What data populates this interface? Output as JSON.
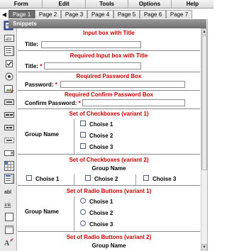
{
  "menu": {
    "items": [
      "Form",
      "Edit",
      "Tools",
      "Options",
      "Help"
    ]
  },
  "tabs": {
    "items": [
      "Page 1",
      "Page 2",
      "Page 3",
      "Page 4",
      "Page 5",
      "Page 6",
      "Page 7"
    ],
    "active": "Page 1"
  },
  "panel": {
    "title": "Snippets"
  },
  "toolbox": {
    "icons": [
      "snippets-icon",
      "text-field-icon",
      "textarea-icon",
      "checkbox-icon",
      "radio-icon",
      "image-edit-icon",
      "button-icon",
      "submit-button-icon",
      "reset-button-icon",
      "hidden-field-icon",
      "select-list-icon",
      "grid-icon",
      "listbox-icon",
      "label-icon",
      "link-icon",
      "frame-icon",
      "frame-alt-icon",
      "style-icon"
    ],
    "abl_label": "abl",
    "link_label": "link"
  },
  "sections": {
    "input_box": {
      "title": "Input box with Title",
      "label": "Title:"
    },
    "req_input_box": {
      "title": "Required Input box with Title",
      "label": "Title:",
      "marker": "*"
    },
    "req_password": {
      "title": "Required Password Box",
      "label": "Password:",
      "marker": "*"
    },
    "req_confirm_password": {
      "title": "Required Confirm Password Box",
      "label": "Confirm Password:",
      "marker": "*"
    },
    "checkboxes_v1": {
      "title": "Set of Checkboxes (variant 1)",
      "group_label": "Group Name",
      "options": [
        "Choise 1",
        "Choise 2",
        "Choise 3"
      ]
    },
    "checkboxes_v2": {
      "title": "Set of Checkboxes (variant 2)",
      "group_label": "Group Name",
      "options": [
        "Choise 1",
        "Choise 2",
        "Choise 3"
      ]
    },
    "radios_v1": {
      "title": "Set of Radio Buttons (variant 1)",
      "group_label": "Group Name",
      "options": [
        "Choise 1",
        "Choise 2",
        "Choise 3"
      ]
    },
    "radios_v2": {
      "title": "Set of Radio Buttons (variant 2)",
      "group_label": "Group Name"
    }
  },
  "colors": {
    "required": "#cc0000",
    "active_tab": "#6d6d6d",
    "header": "#7f7f7f"
  }
}
